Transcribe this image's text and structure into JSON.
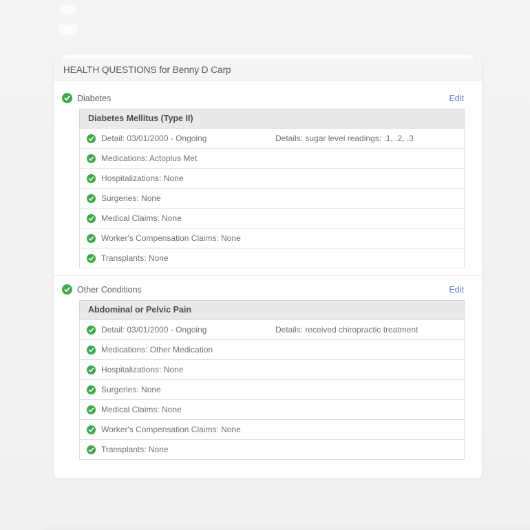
{
  "page": {
    "title": "HEALTH QUESTIONS for Benny D Carp"
  },
  "colors": {
    "check_green": "#3fa94a",
    "edit_link_blue": "#5b7cd0",
    "table_head_bg": "#e9e9ea",
    "card_header_bg": "#f4f4f5"
  },
  "sections": [
    {
      "label": "Diabetes",
      "edit_label": "Edit",
      "condition": "Diabetes Mellitus (Type II)",
      "rows": [
        {
          "label": "Detail: 03/01/2000 - Ongoing",
          "detail": "Details: sugar level readings: .1, .2, .3"
        },
        {
          "label": "Medications: Actoplus Met"
        },
        {
          "label": "Hospitalizations: None"
        },
        {
          "label": "Surgeries: None"
        },
        {
          "label": "Medical Claims: None"
        },
        {
          "label": "Worker's Compensation Claims: None"
        },
        {
          "label": "Transplants: None"
        }
      ]
    },
    {
      "label": "Other Conditions",
      "edit_label": "Edit",
      "condition": "Abdominal or Pelvic Pain",
      "rows": [
        {
          "label": "Detail: 03/01/2000 - Ongoing",
          "detail": "Details: received chiropractic treatment"
        },
        {
          "label": "Medications: Other Medication"
        },
        {
          "label": "Hospitalizations: None"
        },
        {
          "label": "Surgeries: None"
        },
        {
          "label": "Medical Claims: None"
        },
        {
          "label": "Worker's Compensation Claims: None"
        },
        {
          "label": "Transplants: None"
        }
      ]
    }
  ]
}
